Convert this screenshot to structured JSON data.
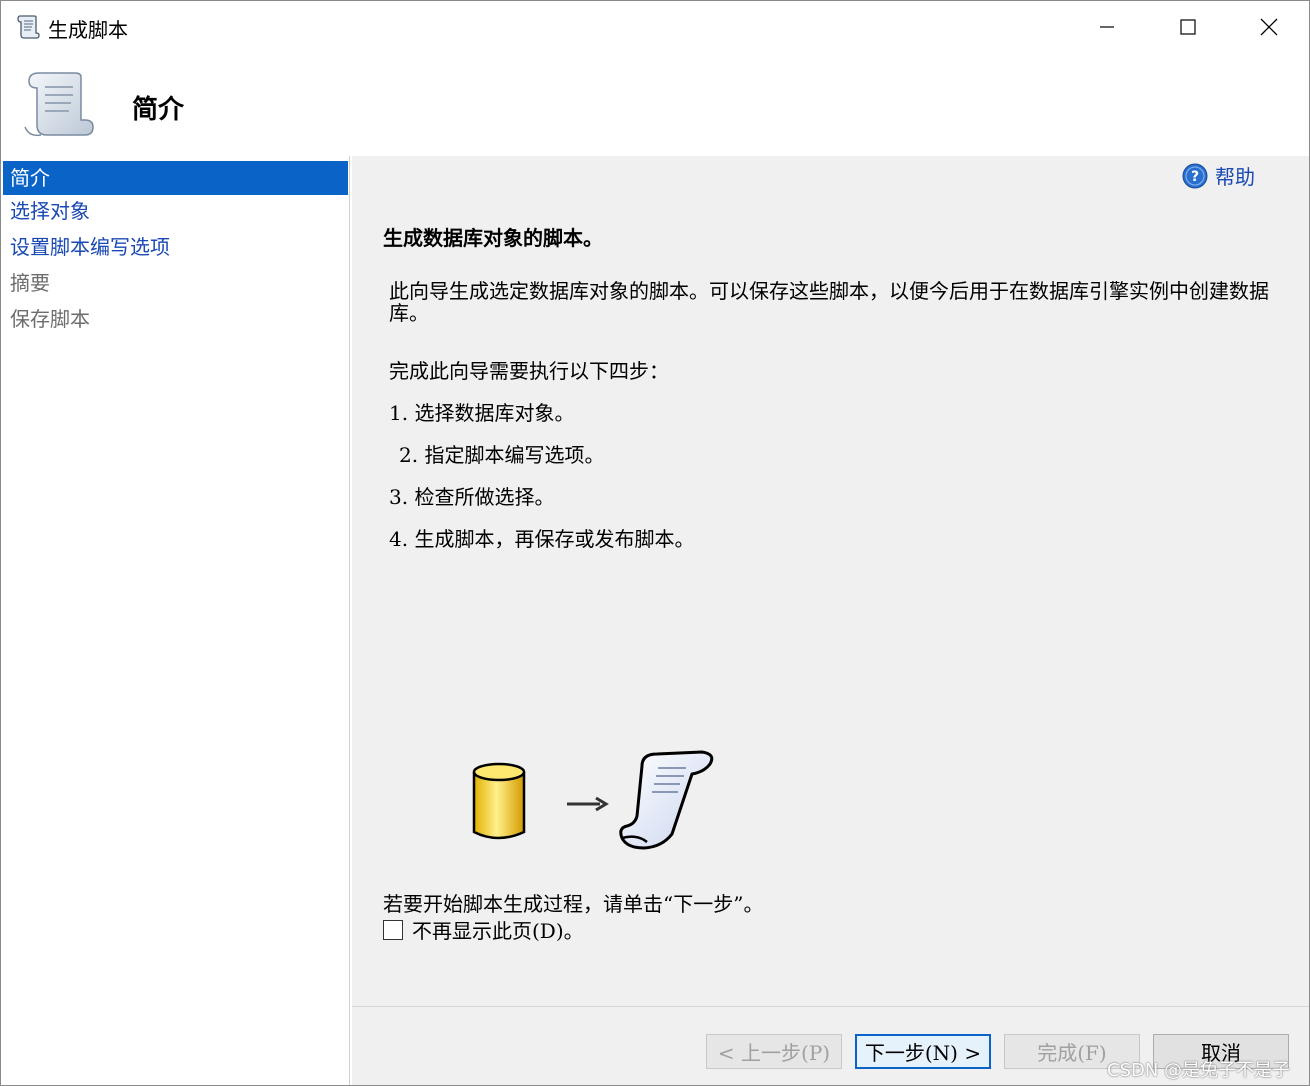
{
  "window": {
    "title": "生成脚本"
  },
  "header": {
    "title": "简介"
  },
  "nav": {
    "items": [
      {
        "label": "简介"
      },
      {
        "label": "选择对象"
      },
      {
        "label": "设置脚本编写选项"
      },
      {
        "label": "摘要"
      },
      {
        "label": "保存脚本"
      }
    ]
  },
  "content": {
    "help_label": "帮助",
    "heading": "生成数据库对象的脚本。",
    "description": "此向导生成选定数据库对象的脚本。可以保存这些脚本，以便今后用于在数据库引擎实例中创建数据库。",
    "steps_intro": "完成此向导需要执行以下四步：",
    "steps": [
      "1. 选择数据库对象。",
      "2. 指定脚本编写选项。",
      "3. 检查所做选择。",
      "4. 生成脚本，再保存或发布脚本。"
    ],
    "start_text": "若要开始脚本生成过程，请单击“下一步”。",
    "dont_show_label": "不再显示此页(D)。"
  },
  "buttons": {
    "back": "< 上一步(P)",
    "next": "下一步(N) >",
    "finish": "完成(F)",
    "cancel": "取消"
  },
  "watermark": "CSDN @是兔子不是子",
  "colors": {
    "nav_active": "#0a64c8",
    "link": "#1a49b4",
    "content_bg": "#f0f0f0"
  }
}
